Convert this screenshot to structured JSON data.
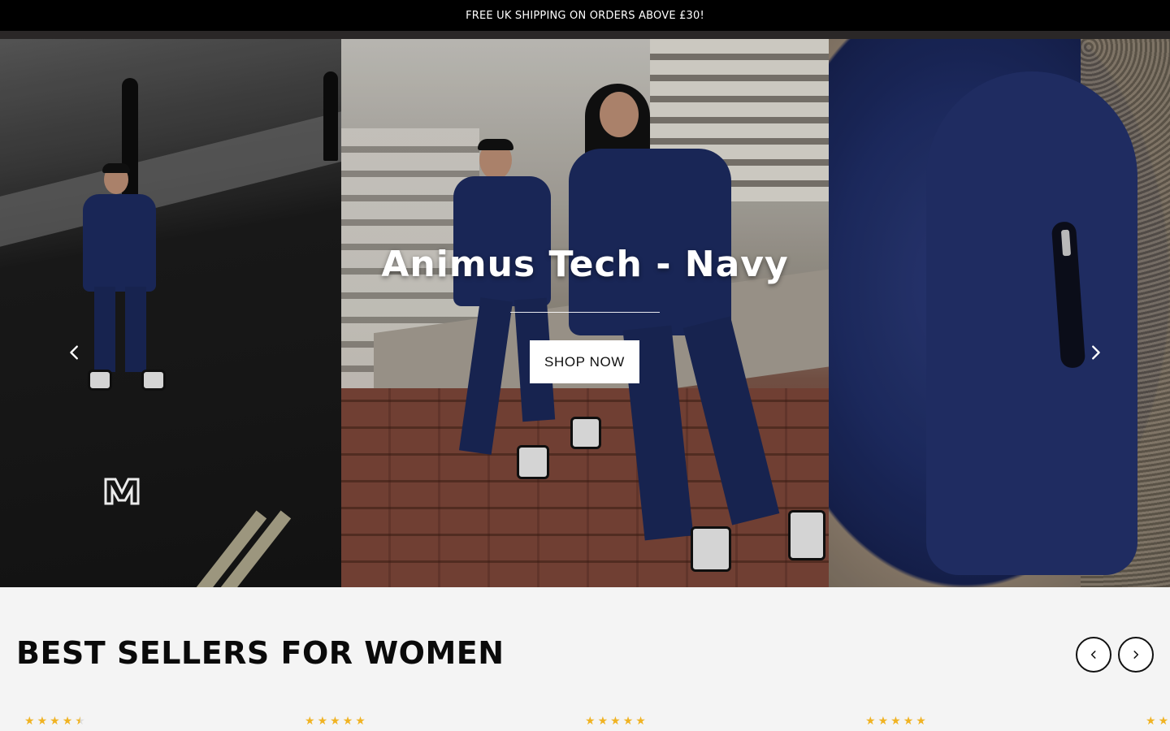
{
  "announcement": {
    "text": "FREE UK SHIPPING ON ORDERS ABOVE £30!"
  },
  "hero": {
    "title": "Animus Tech - Navy",
    "cta_label": "SHOP NOW"
  },
  "best_sellers": {
    "title": "BEST SELLERS FOR WOMEN",
    "ratings": [
      4.5,
      5,
      5,
      5,
      5
    ]
  },
  "colors": {
    "announcement_bg": "#000000",
    "navy": "#1c2a5e",
    "star": "#f0b323"
  },
  "icons": [
    "chevron-left-icon",
    "chevron-right-icon",
    "star-icon",
    "brand-logo"
  ]
}
